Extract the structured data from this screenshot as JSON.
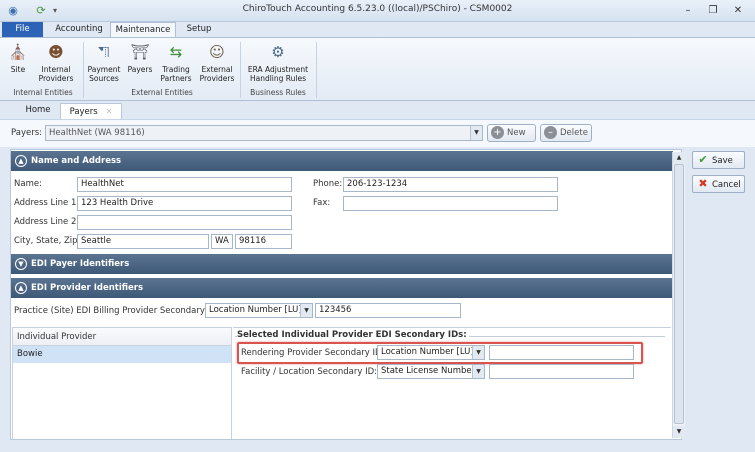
{
  "window": {
    "title": "ChiroTouch Accounting 6.5.23.0 ((local)/PSChiro) - CSM0002",
    "controls": [
      "minimize-icon",
      "restore-icon",
      "close-icon"
    ]
  },
  "ribbon_tabs": [
    "File",
    "Accounting",
    "Maintenance",
    "Setup"
  ],
  "ribbon": {
    "groups": [
      {
        "label": "Internal Entities",
        "buttons": [
          {
            "label": "Site",
            "icon": "building-icon"
          },
          {
            "label": "Internal Providers",
            "icon": "doctor-icon"
          }
        ]
      },
      {
        "label": "External Entities",
        "buttons": [
          {
            "label": "Payment Sources",
            "icon": "payment-source-icon"
          },
          {
            "label": "Payers",
            "icon": "payers-icon"
          },
          {
            "label": "Trading Partners",
            "icon": "trading-partners-icon"
          },
          {
            "label": "External Providers",
            "icon": "external-provider-icon"
          }
        ]
      },
      {
        "label": "Business Rules",
        "buttons": [
          {
            "label": "ERA Adjustment Handling Rules",
            "icon": "era-rules-icon"
          }
        ]
      }
    ]
  },
  "doc_tabs": [
    "Home",
    "Payers"
  ],
  "payers_bar": {
    "label": "Payers:",
    "selected": "HealthNet (WA 98116)",
    "new_label": "New",
    "delete_label": "Delete"
  },
  "side_buttons": {
    "save": "Save",
    "cancel": "Cancel"
  },
  "sections": {
    "name_address": {
      "title": "Name and Address",
      "name_label": "Name:",
      "name": "HealthNet",
      "addr1_label": "Address Line 1:",
      "addr1": "123 Health Drive",
      "addr2_label": "Address Line 2:",
      "addr2": "",
      "csz_label": "City, State, Zip:",
      "city": "Seattle",
      "state": "WA",
      "zip": "98116",
      "phone_label": "Phone:",
      "phone": "206-123-1234",
      "fax_label": "Fax:",
      "fax": ""
    },
    "edi_payer": {
      "title": "EDI Payer Identifiers"
    },
    "edi_provider": {
      "title": "EDI Provider Identifiers",
      "practice_label": "Practice (Site) EDI Billing Provider Secondary ID:",
      "practice_type": "Location Number [LU]",
      "practice_value": "123456",
      "list_header": "Individual Provider",
      "providers": [
        "Bowie"
      ],
      "group_title": "Selected Individual Provider EDI Secondary IDs:",
      "rendering_label": "Rendering Provider Secondary ID:",
      "rendering_type": "Location Number [LU]",
      "rendering_value": "",
      "facility_label": "Facility / Location Secondary ID:",
      "facility_type": "State License Number [0",
      "facility_value": ""
    }
  }
}
